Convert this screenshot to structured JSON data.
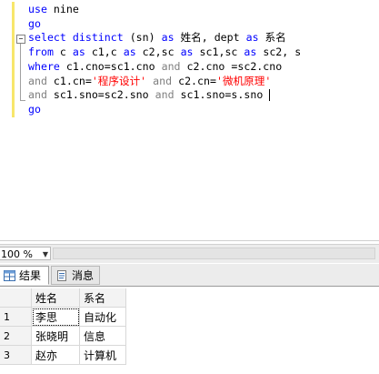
{
  "editor": {
    "lines": [
      [
        {
          "t": "use",
          "c": "kw"
        },
        {
          "t": " nine",
          "c": ""
        }
      ],
      [
        {
          "t": "go",
          "c": "kw"
        }
      ],
      [
        {
          "t": "select",
          "c": "kw"
        },
        {
          "t": " ",
          "c": ""
        },
        {
          "t": "distinct",
          "c": "kw"
        },
        {
          "t": " (sn) ",
          "c": ""
        },
        {
          "t": "as",
          "c": "kw"
        },
        {
          "t": " 姓名, dept ",
          "c": ""
        },
        {
          "t": "as",
          "c": "kw"
        },
        {
          "t": " 系名",
          "c": ""
        }
      ],
      [
        {
          "t": "from",
          "c": "kw"
        },
        {
          "t": " c ",
          "c": ""
        },
        {
          "t": "as",
          "c": "kw"
        },
        {
          "t": " c1,c ",
          "c": ""
        },
        {
          "t": "as",
          "c": "kw"
        },
        {
          "t": " c2,sc ",
          "c": ""
        },
        {
          "t": "as",
          "c": "kw"
        },
        {
          "t": " sc1,sc ",
          "c": ""
        },
        {
          "t": "as",
          "c": "kw"
        },
        {
          "t": " sc2, s",
          "c": ""
        }
      ],
      [
        {
          "t": "where",
          "c": "kw"
        },
        {
          "t": " c1.cno=sc1.cno ",
          "c": ""
        },
        {
          "t": "and",
          "c": "gr"
        },
        {
          "t": " c2.cno =sc2.cno",
          "c": ""
        }
      ],
      [
        {
          "t": "and",
          "c": "gr"
        },
        {
          "t": " c1.cn=",
          "c": ""
        },
        {
          "t": "'程序设计'",
          "c": "str"
        },
        {
          "t": " ",
          "c": ""
        },
        {
          "t": "and",
          "c": "gr"
        },
        {
          "t": " c2.cn=",
          "c": ""
        },
        {
          "t": "'微机原理'",
          "c": "str"
        }
      ],
      [
        {
          "t": "and",
          "c": "gr"
        },
        {
          "t": " sc1.sno=sc2.sno ",
          "c": ""
        },
        {
          "t": "and",
          "c": "gr"
        },
        {
          "t": " sc1.sno=s.sno ",
          "c": ""
        }
      ],
      [
        {
          "t": "go",
          "c": "kw"
        }
      ]
    ],
    "collapse_symbol": "−"
  },
  "zoom": {
    "value": "100 %"
  },
  "tabs": [
    {
      "label": "结果",
      "active": true
    },
    {
      "label": "消息",
      "active": false
    }
  ],
  "results": {
    "columns": [
      "姓名",
      "系名"
    ],
    "rows": [
      {
        "num": "1",
        "cells": [
          "李思",
          "自动化"
        ]
      },
      {
        "num": "2",
        "cells": [
          "张晓明",
          "信息"
        ]
      },
      {
        "num": "3",
        "cells": [
          "赵亦",
          "计算机"
        ]
      }
    ]
  }
}
